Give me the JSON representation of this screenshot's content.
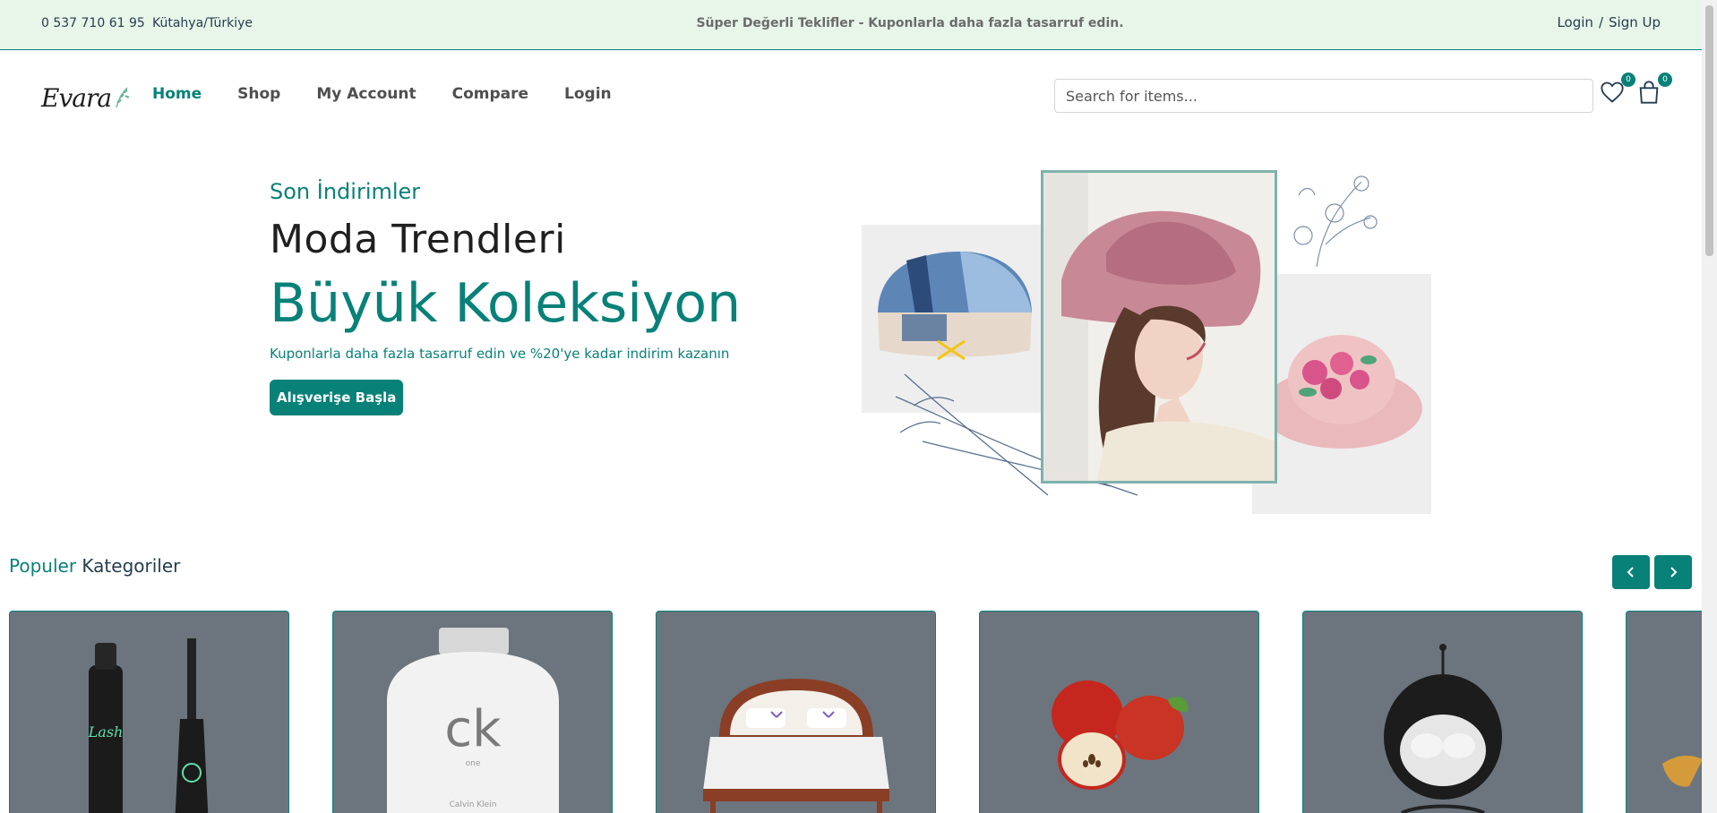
{
  "topbar": {
    "phone": "0 537 710 61 95",
    "location": "Kütahya/Türkiye",
    "promo": "Süper Değerli Teklifler - Kuponlarla daha fazla tasarruf edin.",
    "login": "Login",
    "separator": "/",
    "signup": "Sign Up"
  },
  "header": {
    "logo_text": "Evara",
    "nav": [
      "Home",
      "Shop",
      "My Account",
      "Compare",
      "Login"
    ],
    "search_placeholder": "Search for items...",
    "wishlist_count": "0",
    "cart_count": "0"
  },
  "hero": {
    "subtitle": "Son İndirimler",
    "title": "Moda Trendleri",
    "title2": "Büyük Koleksiyon",
    "description": "Kuponlarla daha fazla tasarruf edin ve %20'ye kadar indirim kazanın",
    "button": "Alışverişe Başla"
  },
  "categories": {
    "title_accent": "Populer",
    "title_rest": "Kategoriler",
    "items": [
      "mascara",
      "perfume",
      "bed",
      "apples",
      "hanging-chair",
      "partial-item"
    ]
  },
  "colors": {
    "brand": "#088178",
    "topbar_bg": "#e8f6ea",
    "card_bg": "#6c757d"
  }
}
